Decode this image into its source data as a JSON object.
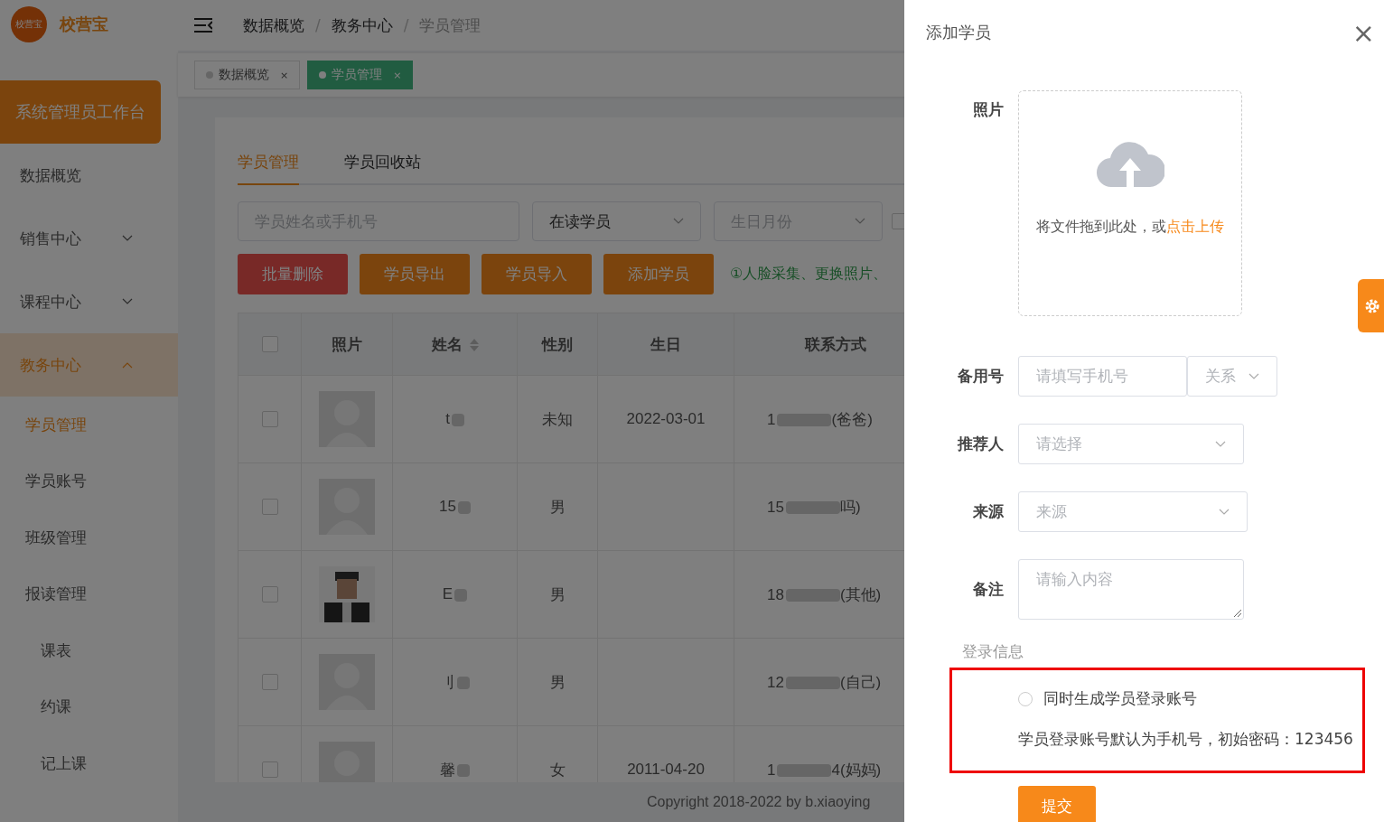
{
  "logo": {
    "badge": "校营宝",
    "name": "校营宝"
  },
  "breadcrumb": [
    "数据概览",
    "教务中心",
    "学员管理"
  ],
  "breadcrumb_separator": "/",
  "tabs": [
    {
      "label": "数据概览",
      "selected": false,
      "close": "×"
    },
    {
      "label": "学员管理",
      "selected": true,
      "close": "×"
    }
  ],
  "workbench": "系统管理员工作台",
  "sidebar": [
    {
      "label": "数据概览",
      "has_children": false,
      "selected": false
    },
    {
      "label": "销售中心",
      "expanded": false,
      "has_children": true,
      "selected": false
    },
    {
      "label": "课程中心",
      "expanded": false,
      "has_children": true,
      "selected": false
    },
    {
      "label": "教务中心",
      "expanded": true,
      "has_children": true,
      "selected": true,
      "children": [
        {
          "label": "学员管理",
          "selected": true
        },
        {
          "label": "学员账号",
          "selected": false
        },
        {
          "label": "班级管理",
          "selected": false
        },
        {
          "label": "报读管理",
          "selected": false
        },
        {
          "label": "课表",
          "selected": false
        },
        {
          "label": "约课",
          "selected": false
        },
        {
          "label": "记上课",
          "selected": false
        }
      ]
    }
  ],
  "page_tabs": [
    {
      "label": "学员管理",
      "selected": true
    },
    {
      "label": "学员回收站",
      "selected": false
    }
  ],
  "filters": {
    "search_placeholder": "学员姓名或手机号",
    "status": "在读学员",
    "month_placeholder": "生日月份",
    "checkbox_checked": false
  },
  "actions": [
    {
      "label": "批量删除",
      "kind": "danger"
    },
    {
      "label": "学员导出",
      "kind": "primary"
    },
    {
      "label": "学员导入",
      "kind": "primary"
    },
    {
      "label": "添加学员",
      "kind": "primary"
    }
  ],
  "hint": "①人脸采集、更换照片、",
  "table": {
    "all_checked": false,
    "columns": [
      "照片",
      "姓名",
      "性别",
      "生日",
      "联系方式"
    ],
    "rows": [
      {
        "kind": "avatar",
        "name": "t",
        "gender": "未知",
        "birthday": "2022-03-01",
        "contact_start": "1",
        "contact_end": "(爸爸)",
        "checked": false
      },
      {
        "kind": "avatar",
        "name": "15",
        "gender": "男",
        "contact_start": "15",
        "contact_end": "吗)",
        "checked": false
      },
      {
        "kind": "picture",
        "name": "E",
        "gender": "男",
        "contact_start": "18",
        "contact_end": "(其他)",
        "checked": false
      },
      {
        "kind": "avatar",
        "name": "刂",
        "gender": "男",
        "contact_start": "12",
        "contact_end": "(自己)",
        "checked": false
      },
      {
        "kind": "avatar",
        "name": "馨",
        "gender": "女",
        "birthday": "2011-04-20",
        "contact_start": "1",
        "contact_end": "4(妈妈)",
        "checked": false
      }
    ]
  },
  "footer": "Copyright 2018-2022 by  b.xiaoying",
  "drawer": {
    "title": "添加学员",
    "close": "×",
    "photo_label": "照片",
    "upload_text": "将文件拖到此处，或",
    "upload_link": "点击上传",
    "fields": [
      {
        "label": "备用号",
        "kind": "phone",
        "placeholder": "请填写手机号",
        "select": "关系"
      },
      {
        "label": "推荐人",
        "kind": "select",
        "placeholder": "请选择"
      },
      {
        "label": "来源",
        "kind": "select",
        "placeholder": "来源"
      },
      {
        "label": "备注",
        "kind": "textarea",
        "placeholder": "请输入内容"
      }
    ],
    "section": "登录信息",
    "login": {
      "option": "同时生成学员登录账号",
      "checked": false,
      "note": "学员登录账号默认为手机号，初始密码：123456"
    },
    "submit": "提交"
  }
}
